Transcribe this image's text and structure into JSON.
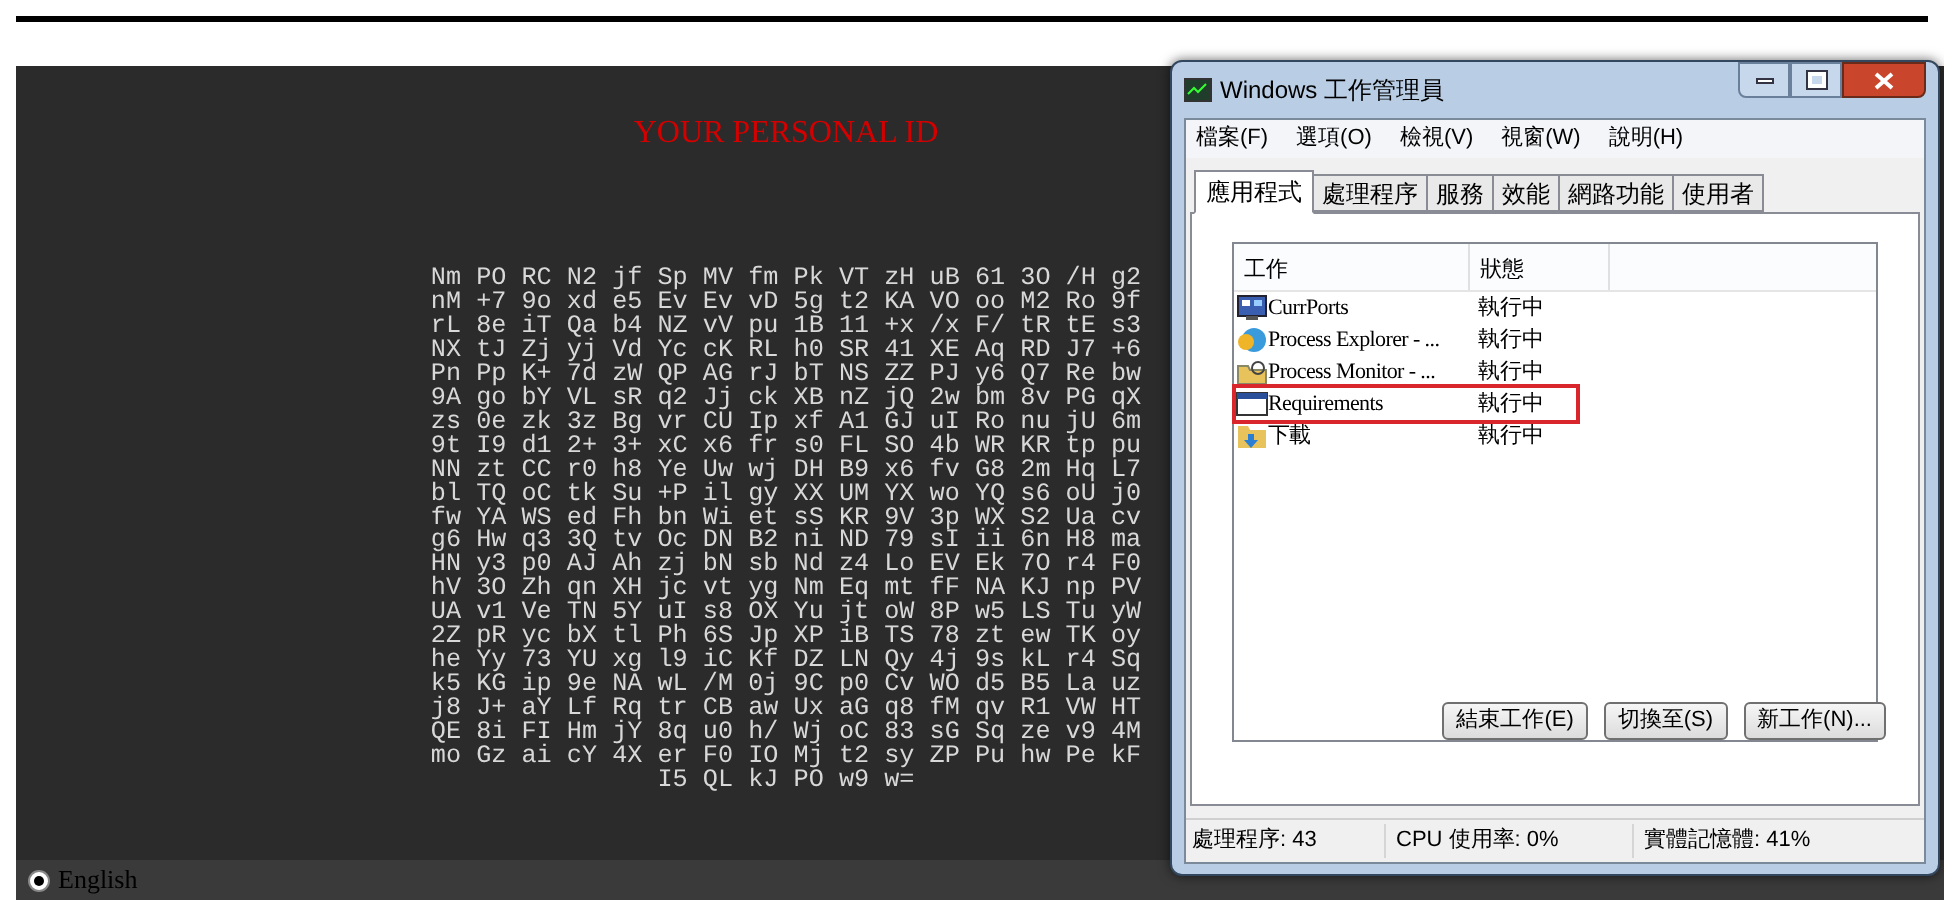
{
  "ransom_page": {
    "title": "YOUR PERSONAL ID",
    "id_lines": [
      "Nm PO RC N2 jf Sp MV fm Pk VT zH uB 61 3O /H g2",
      "nM +7 9o xd e5 Ev Ev vD 5g t2 KA VO oo M2 Ro 9f",
      "rL 8e iT Qa b4 NZ vV pu 1B 11 +x /x F/ tR tE s3",
      "NX tJ Zj yj Vd Yc cK RL h0 SR 41 XE Aq RD J7 +6",
      "Pn Pp K+ 7d zW QP AG rJ bT NS ZZ PJ y6 Q7 Re bw",
      "9A go bY VL sR q2 Jj ck XB nZ jQ 2w bm 8v PG qX",
      "zs 0e zk 3z Bg vr CU Ip xf A1 GJ uI Ro nu jU 6m",
      "9t I9 d1 2+ 3+ xC x6 fr s0 FL SO 4b WR KR tp pu",
      "NN zt CC r0 h8 Ye Uw wj DH B9 x6 fv G8 2m Hq L7",
      "bl TQ oC tk Su +P il gy XX UM YX wo YQ s6 oU j0",
      "fw YA WS ed Fh bn Wi et sS KR 9V 3p WX S2 Ua cv",
      "g6 Hw q3 3Q tv Oc DN B2 ni ND 79 sI ii 6n H8 ma",
      "HN y3 p0 AJ Ah zj bN sb Nd z4 Lo EV Ek 7O r4 F0",
      "hV 3O Zh qn XH jc vt yg Nm Eq mt fF NA KJ np PV",
      "UA v1 Ve TN 5Y uI s8 OX Yu jt oW 8P w5 LS Tu yW",
      "2Z pR yc bX tl Ph 6S Jp XP iB TS 78 zt ew TK oy",
      "he Yy 73 YU xg l9 iC Kf DZ LN Qy 4j 9s kL r4 Sq",
      "k5 KG ip 9e NA wL /M 0j 9C p0 Cv WO d5 B5 La uz",
      "j8 J+ aY Lf Rq tr CB aw Ux aG q8 fM qv R1 VW HT",
      "QE 8i FI Hm jY 8q u0 h/ Wj oC 83 sG Sq ze v9 4M",
      "mo Gz ai cY 4X er F0 IO Mj t2 sy ZP Pu hw Pe kF",
      "I5 QL kJ PO w9 w="
    ],
    "language_options": [
      {
        "label": "English",
        "selected": true
      }
    ]
  },
  "task_manager": {
    "title": "Windows 工作管理員",
    "menu": [
      "檔案(F)",
      "選項(O)",
      "檢視(V)",
      "視窗(W)",
      "說明(H)"
    ],
    "tabs": [
      {
        "label": "應用程式",
        "selected": true
      },
      {
        "label": "處理程序",
        "selected": false
      },
      {
        "label": "服務",
        "selected": false
      },
      {
        "label": "效能",
        "selected": false
      },
      {
        "label": "網路功能",
        "selected": false
      },
      {
        "label": "使用者",
        "selected": false
      }
    ],
    "columns": [
      "工作",
      "狀態"
    ],
    "rows": [
      {
        "kind": "ports",
        "name": "CurrPorts",
        "status": "執行中",
        "highlighted": false
      },
      {
        "kind": "explorer",
        "name": "Process Explorer - ...",
        "status": "執行中",
        "highlighted": false
      },
      {
        "kind": "monitor",
        "name": "Process Monitor - ...",
        "status": "執行中",
        "highlighted": false
      },
      {
        "kind": "window",
        "name": "Requirements",
        "status": "執行中",
        "highlighted": true
      },
      {
        "kind": "folder",
        "name": "下載",
        "status": "執行中",
        "highlighted": false
      }
    ],
    "buttons": [
      "結束工作(E)",
      "切換至(S)",
      "新工作(N)..."
    ],
    "status_bar": [
      "處理程序: 43",
      "CPU 使用率: 0%",
      "實體記憶體: 41%"
    ]
  }
}
